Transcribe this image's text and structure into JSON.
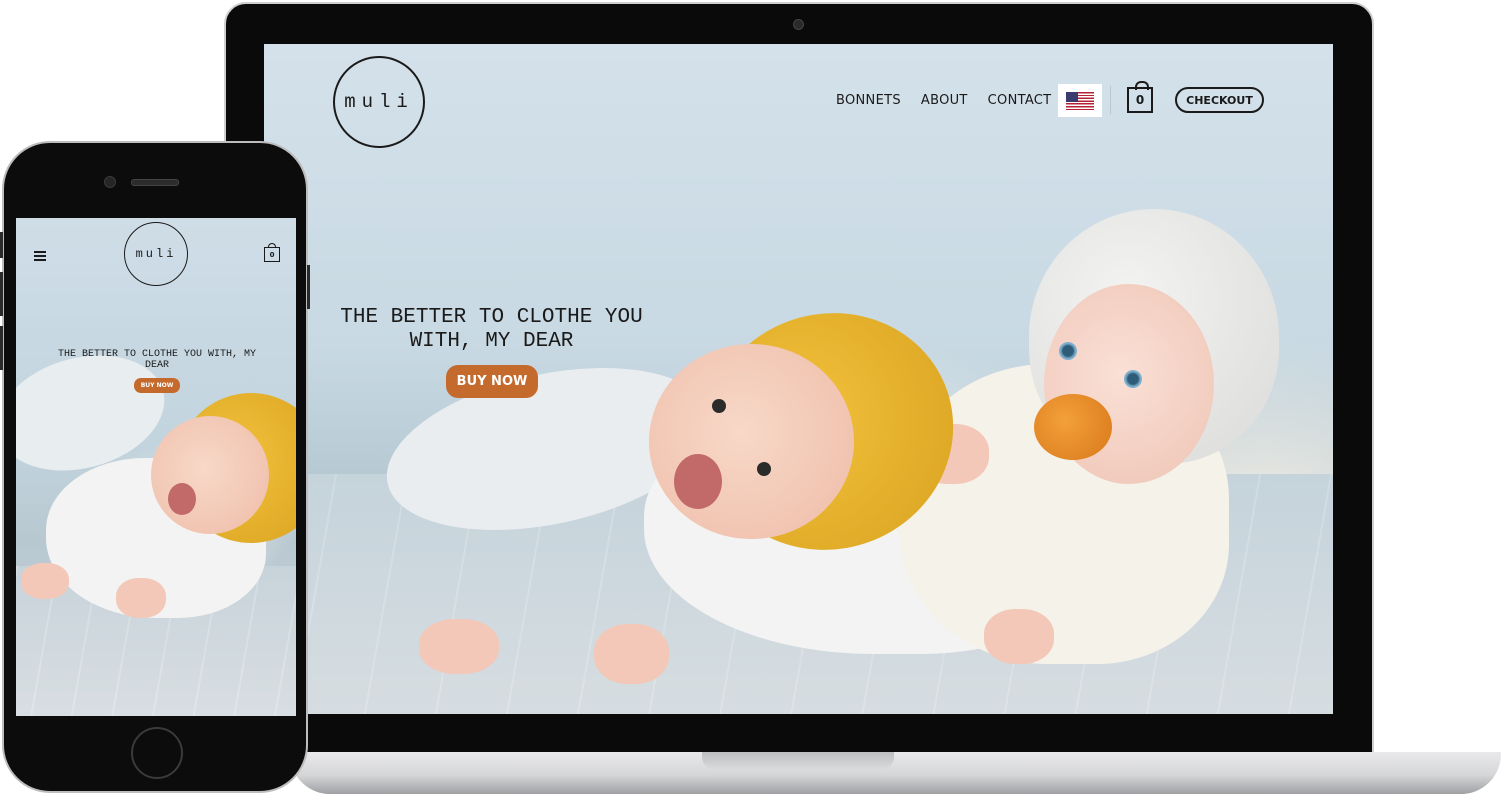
{
  "brand": {
    "logo_text": "muli"
  },
  "desktop": {
    "nav": {
      "items": [
        "BONNETS",
        "ABOUT",
        "CONTACT"
      ],
      "flag_icon": "us-flag-icon",
      "cart_count": "0",
      "checkout_label": "CHECKOUT"
    },
    "hero": {
      "title_line1": "THE BETTER TO CLOTHE YOU",
      "title_line2": "WITH, MY DEAR",
      "button_label": "BUY NOW"
    }
  },
  "mobile": {
    "menu_icon": "hamburger-icon",
    "cart_count": "0",
    "hero": {
      "title_line1": "THE BETTER TO CLOTHE YOU WITH, MY",
      "title_line2": "DEAR",
      "button_label": "BUY NOW"
    }
  },
  "colors": {
    "accent": "#c56a2d",
    "text": "#1a1a1a",
    "sky": "#d4e1ea",
    "bonnet_yellow": "#f2c23d"
  }
}
